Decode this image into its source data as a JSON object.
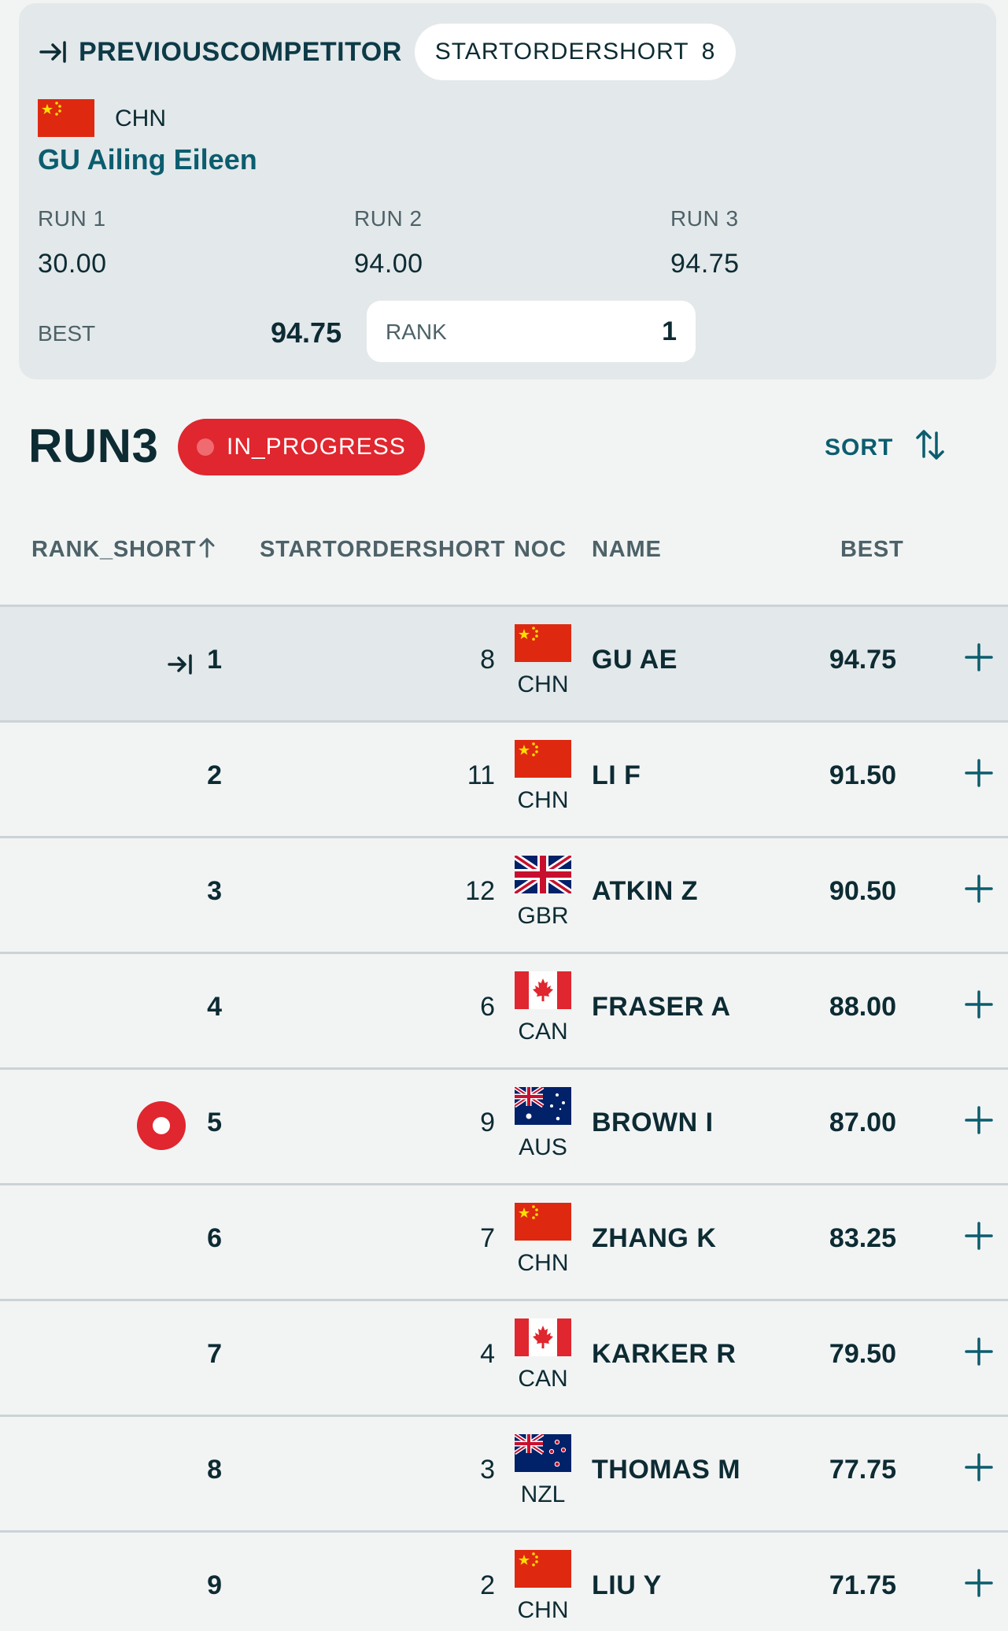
{
  "previous_competitor": {
    "label": "PREVIOUSCOMPETITOR",
    "start_order_label": "STARTORDERSHORT",
    "start_order": "8",
    "noc": "CHN",
    "name": "GU Ailing Eileen",
    "runs": [
      {
        "label": "RUN 1",
        "value": "30.00"
      },
      {
        "label": "RUN 2",
        "value": "94.00"
      },
      {
        "label": "RUN 3",
        "value": "94.75"
      }
    ],
    "best_label": "BEST",
    "best_value": "94.75",
    "rank_label": "RANK",
    "rank_value": "1"
  },
  "run": {
    "title": "RUN3",
    "status": "IN_PROGRESS",
    "sort_label": "SORT"
  },
  "columns": {
    "rank": "RANK_SHORT",
    "start": "STARTORDERSHORT",
    "noc": "NOC",
    "name": "NAME",
    "best": "BEST"
  },
  "rows": [
    {
      "rank": "1",
      "start": "8",
      "noc": "CHN",
      "name": "GU AE",
      "best": "94.75",
      "flag": "chn-flag-icon"
    },
    {
      "rank": "2",
      "start": "11",
      "noc": "CHN",
      "name": "LI F",
      "best": "91.50",
      "flag": "chn-flag-icon"
    },
    {
      "rank": "3",
      "start": "12",
      "noc": "GBR",
      "name": "ATKIN Z",
      "best": "90.50",
      "flag": "gbr-flag-icon"
    },
    {
      "rank": "4",
      "start": "6",
      "noc": "CAN",
      "name": "FRASER A",
      "best": "88.00",
      "flag": "can-flag-icon"
    },
    {
      "rank": "5",
      "start": "9",
      "noc": "AUS",
      "name": "BROWN I",
      "best": "87.00",
      "flag": "aus-flag-icon"
    },
    {
      "rank": "6",
      "start": "7",
      "noc": "CHN",
      "name": "ZHANG K",
      "best": "83.25",
      "flag": "chn-flag-icon"
    },
    {
      "rank": "7",
      "start": "4",
      "noc": "CAN",
      "name": "KARKER R",
      "best": "79.50",
      "flag": "can-flag-icon"
    },
    {
      "rank": "8",
      "start": "3",
      "noc": "NZL",
      "name": "THOMAS M",
      "best": "77.75",
      "flag": "nzl-flag-icon"
    },
    {
      "rank": "9",
      "start": "2",
      "noc": "CHN",
      "name": "LIU Y",
      "best": "71.75",
      "flag": "chn-flag-icon"
    }
  ],
  "colors": {
    "accent": "#0b5d6e",
    "live": "#e0262e",
    "card": "#e3e8ea",
    "background": "#f2f4f4"
  }
}
